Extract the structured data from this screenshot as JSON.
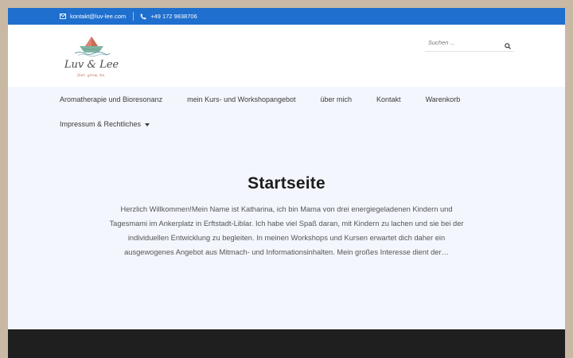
{
  "topbar": {
    "email": "kontakt@luv-lee.com",
    "phone": "+49 172 9838706"
  },
  "logo": {
    "name": "Luv & Lee",
    "tagline": "feel. grow. be."
  },
  "search": {
    "placeholder": "Suchen ..."
  },
  "nav": {
    "items": [
      {
        "label": "Aromatherapie und Bioresonanz"
      },
      {
        "label": "mein Kurs- und Workshopangebot"
      },
      {
        "label": "über mich"
      },
      {
        "label": "Kontakt"
      },
      {
        "label": "Warenkorb"
      },
      {
        "label": "Impressum & Rechtliches"
      }
    ]
  },
  "page": {
    "title": "Startseite",
    "intro": "Herzlich Willkommen!Mein Name ist Katharina, ich bin Mama von drei energiegeladenen Kindern und Tagesmami im Ankerplatz in Erftstadt-Liblar. Ich habe viel Spaß daran, mit Kindern zu lachen und sie bei der individuellen Entwicklung zu begleiten. In meinen Workshops und Kursen erwartet dich daher ein ausgewogenes Angebot aus Mitmach- und Informationsinhalten. Mein großes Interesse dient der…"
  },
  "colors": {
    "topbar": "#1f6fcf",
    "content_bg": "#f3f6fd",
    "footer": "#1f1f1f",
    "page_bg": "#c9b9a4"
  }
}
